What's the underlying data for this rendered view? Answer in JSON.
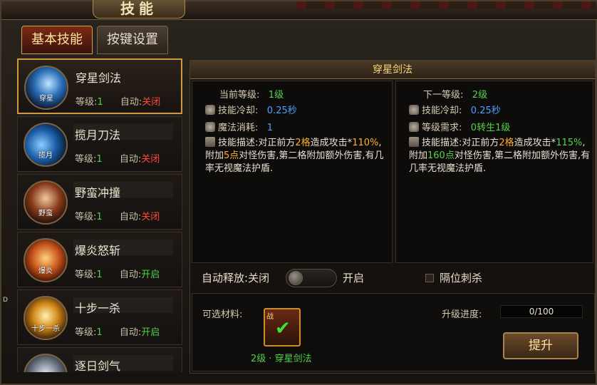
{
  "window": {
    "title": "技能"
  },
  "tabs": [
    {
      "label": "基本技能",
      "active": true
    },
    {
      "label": "按键设置",
      "active": false
    }
  ],
  "skills": [
    {
      "name": "穿星剑法",
      "icon_text": "穿星",
      "level_label": "等级:",
      "level": "1",
      "auto_label": "自动:",
      "auto": "关闭",
      "auto_color": "#ff4a3a",
      "icon": "blue-slash-icon"
    },
    {
      "name": "揽月刀法",
      "icon_text": "揽月",
      "level_label": "等级:",
      "level": "1",
      "auto_label": "自动:",
      "auto": "关闭",
      "auto_color": "#ff4a3a",
      "icon": "blue-arc-icon"
    },
    {
      "name": "野蛮冲撞",
      "icon_text": "野蛮",
      "level_label": "等级:",
      "level": "1",
      "auto_label": "自动:",
      "auto": "关闭",
      "auto_color": "#ff4a3a",
      "icon": "charge-icon"
    },
    {
      "name": "爆炎怒斩",
      "icon_text": "爆炎",
      "level_label": "等级:",
      "level": "1",
      "auto_label": "自动:",
      "auto": "开启",
      "auto_color": "#52d24a",
      "icon": "fire-slash-icon"
    },
    {
      "name": "十步一杀",
      "icon_text": "十步一杀",
      "level_label": "等级:",
      "level": "1",
      "auto_label": "自动:",
      "auto": "开启",
      "auto_color": "#52d24a",
      "icon": "golden-strike-icon"
    },
    {
      "name": "逐日剑气",
      "icon_text": "",
      "level_label": "",
      "level": "",
      "auto_label": "",
      "auto": "",
      "auto_color": "#52d24a",
      "icon": "steel-blade-icon"
    }
  ],
  "detail": {
    "title": "穿星剑法",
    "current": {
      "level_label": "当前等级:",
      "level_value": "1级",
      "cooldown_label": "技能冷却:",
      "cooldown_value": "0.25秒",
      "cost_label": "魔法消耗:",
      "cost_value": "1",
      "desc_prefix": "技能描述:对正前方",
      "desc_range": "2格",
      "desc_mid1": "造成攻击*",
      "desc_percent": "110%",
      "desc_mid2": ",附加",
      "desc_bonus": "5点",
      "desc_tail": "对怪伤害,第二格附加额外伤害,有几率无视魔法护盾."
    },
    "next": {
      "level_label": "下一等级:",
      "level_value": "2级",
      "cooldown_label": "技能冷却:",
      "cooldown_value": "0.25秒",
      "req_label": "等级需求:",
      "req_value": "0转生1级",
      "desc_prefix": "技能描述:对正前方",
      "desc_range": "2格",
      "desc_mid1": "造成攻击*",
      "desc_percent": "115%",
      "desc_mid2": ",附加",
      "desc_bonus": "160点",
      "desc_tail": "对怪伤害,第二格附加额外伤害,有几率无视魔法护盾."
    },
    "auto_cast_label": "自动释放:",
    "auto_cast_value": "关闭",
    "auto_cast_on_label": "开启",
    "separated_kill_label": "隔位刺杀",
    "materials_label": "可选材料:",
    "material": {
      "tag": "战",
      "name": "2级 · 穿星剑法"
    },
    "progress_label": "升级进度:",
    "progress_value": "0/100",
    "progress_fraction": 0,
    "upgrade_label": "提升"
  },
  "edge_label": "D"
}
